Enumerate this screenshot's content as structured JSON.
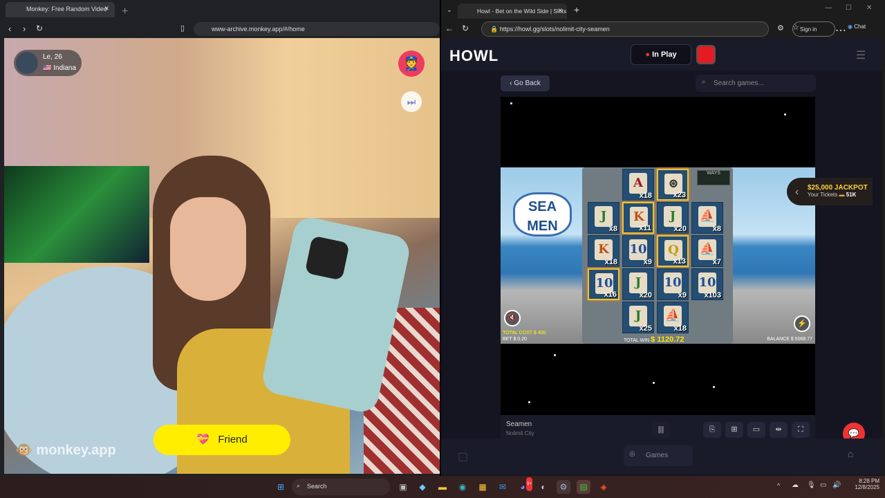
{
  "left_browser": {
    "tab_title": "Monkey: Free Random Video",
    "url": "www-archive.monkey.app/#/home"
  },
  "monkey": {
    "user_name": "Le, 26",
    "user_location": "Indiana",
    "friend_label": "Friend",
    "logo_text": "monkey.app"
  },
  "right_browser": {
    "tab_title": "Howl - Bet on the Wild Side | Slots",
    "url": "https://howl.gg/slots/nolimit-city-seamen",
    "sign_in": "Sign in",
    "chat": "Chat"
  },
  "howl": {
    "logo": "HOWL",
    "in_play": "In Play",
    "go_back": "Go Back",
    "search_placeholder": "Search games...",
    "game_name": "Seamen",
    "provider": "Nolimit City",
    "games_label": "Games"
  },
  "jackpot": {
    "title": "$25,000 JACKPOT",
    "tickets_label": "Your Tickets",
    "tickets": "51K"
  },
  "slot": {
    "logo": "SEA MEN",
    "ways_label": "WAYS",
    "total_cost_label": "TOTAL COST",
    "total_cost": "$ 400",
    "bet_label": "BET",
    "bet": "$ 0.20",
    "total_win_label": "TOTAL WIN",
    "total_win": "$ 1120.72",
    "balance_label": "BALANCE",
    "balance": "$ 5068.77",
    "grid": [
      [
        null,
        {
          "s": "A",
          "m": "x18",
          "c": "#9b1c1c"
        },
        {
          "s": "⊛",
          "m": "x23",
          "c": "#333",
          "hl": true
        },
        null
      ],
      [
        {
          "s": "J",
          "m": "x8",
          "c": "#2c7a2c"
        },
        {
          "s": "K",
          "m": "x11",
          "c": "#c0521b",
          "hl": true
        },
        {
          "s": "J",
          "m": "x20",
          "c": "#2c7a2c"
        },
        {
          "s": "⛵",
          "m": "x8",
          "c": "#555"
        }
      ],
      [
        {
          "s": "K",
          "m": "x18",
          "c": "#c0521b"
        },
        {
          "s": "10",
          "m": "x9",
          "c": "#1f4f9c"
        },
        {
          "s": "Q",
          "m": "x13",
          "c": "#c99a10",
          "hl": true
        },
        {
          "s": "⛵",
          "m": "x7",
          "c": "#555"
        }
      ],
      [
        {
          "s": "10",
          "m": "x16",
          "c": "#1f4f9c",
          "hl": true
        },
        {
          "s": "J",
          "m": "x20",
          "c": "#2c7a2c"
        },
        {
          "s": "10",
          "m": "x9",
          "c": "#1f4f9c"
        },
        {
          "s": "10",
          "m": "x103",
          "c": "#1f4f9c"
        }
      ],
      [
        null,
        {
          "s": "J",
          "m": "x25",
          "c": "#2c7a2c"
        },
        {
          "s": "⛵",
          "m": "x18",
          "c": "#555"
        },
        null
      ]
    ]
  },
  "taskbar": {
    "search": "Search",
    "time": "8:28 PM",
    "date": "12/8/2025",
    "discord_badge": "9+"
  }
}
